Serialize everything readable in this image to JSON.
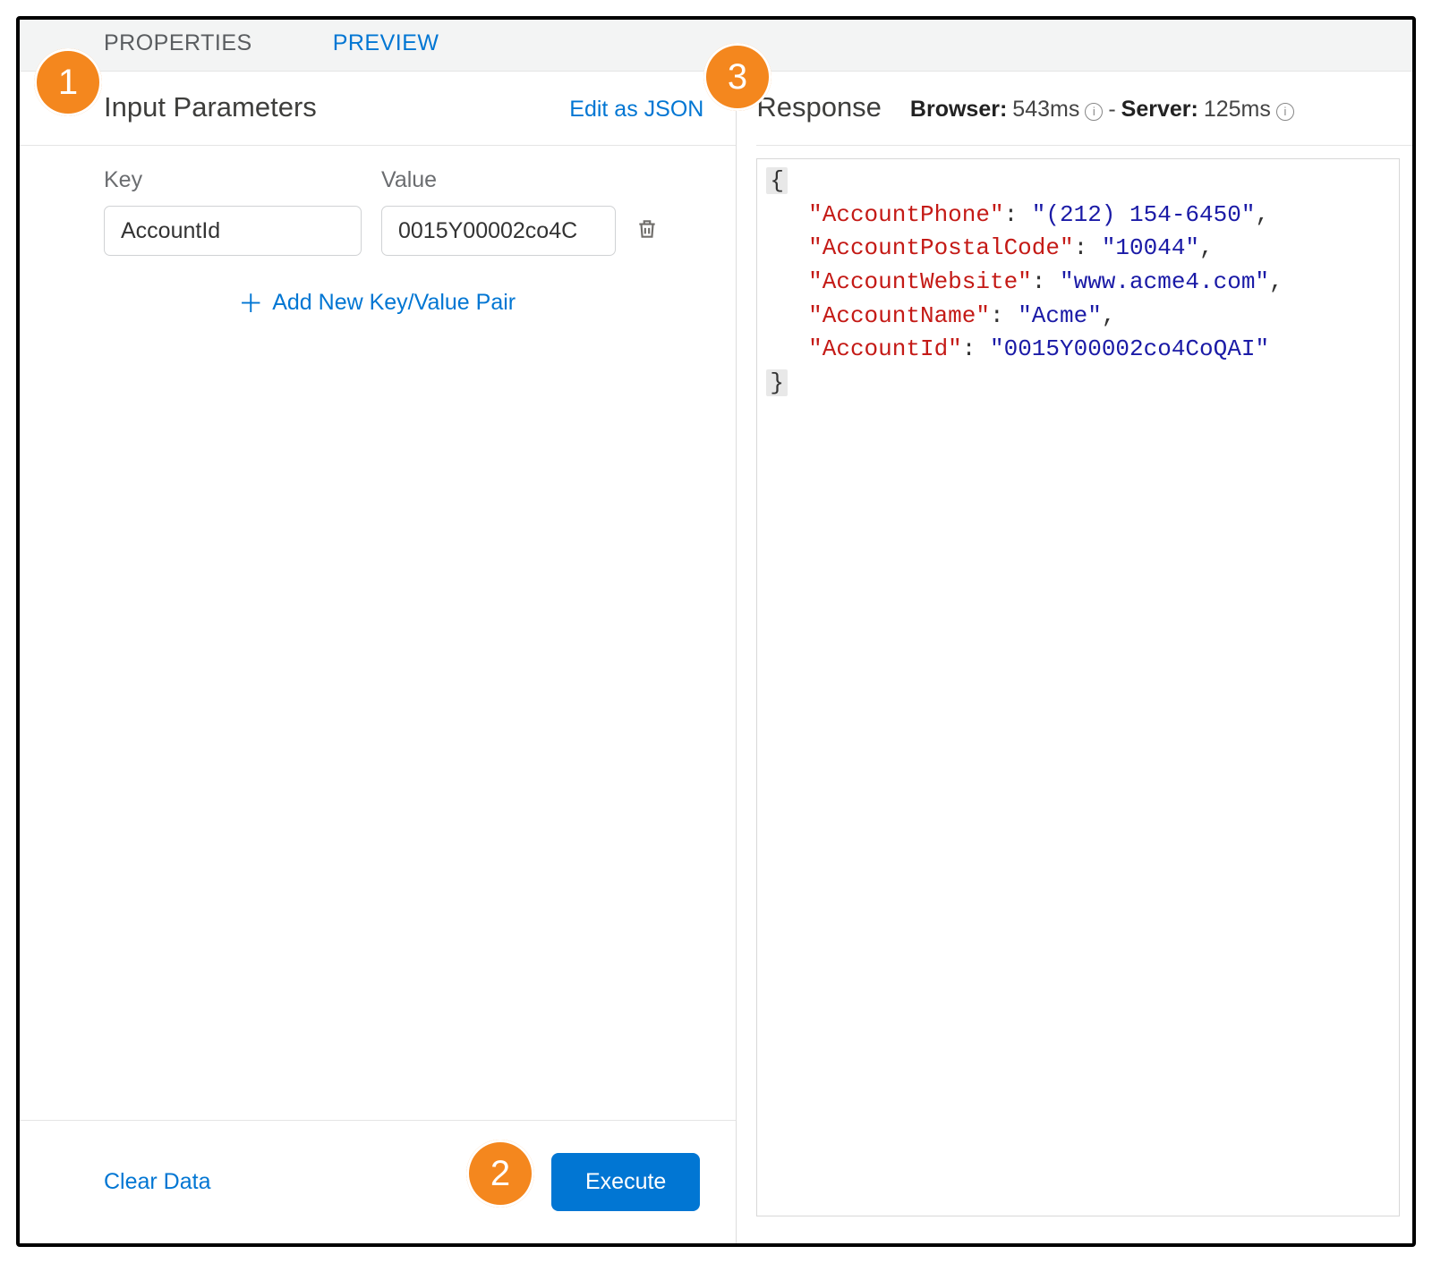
{
  "tabs": {
    "properties": "PROPERTIES",
    "preview": "PREVIEW"
  },
  "left": {
    "title": "Input Parameters",
    "edit_json": "Edit as JSON",
    "key_label": "Key",
    "value_label": "Value",
    "row": {
      "key": "AccountId",
      "value": "0015Y00002co4C"
    },
    "add_new": "Add New Key/Value Pair",
    "clear": "Clear Data",
    "execute": "Execute"
  },
  "right": {
    "title": "Response",
    "browser_label": "Browser:",
    "browser_value": "543ms",
    "server_label": "Server:",
    "server_value": "125ms",
    "dash": " - ",
    "json": {
      "AccountPhone": "(212) 154-6450",
      "AccountPostalCode": "10044",
      "AccountWebsite": "www.acme4.com",
      "AccountName": "Acme",
      "AccountId": "0015Y00002co4CoQAI"
    }
  },
  "callouts": {
    "c1": "1",
    "c2": "2",
    "c3": "3"
  }
}
